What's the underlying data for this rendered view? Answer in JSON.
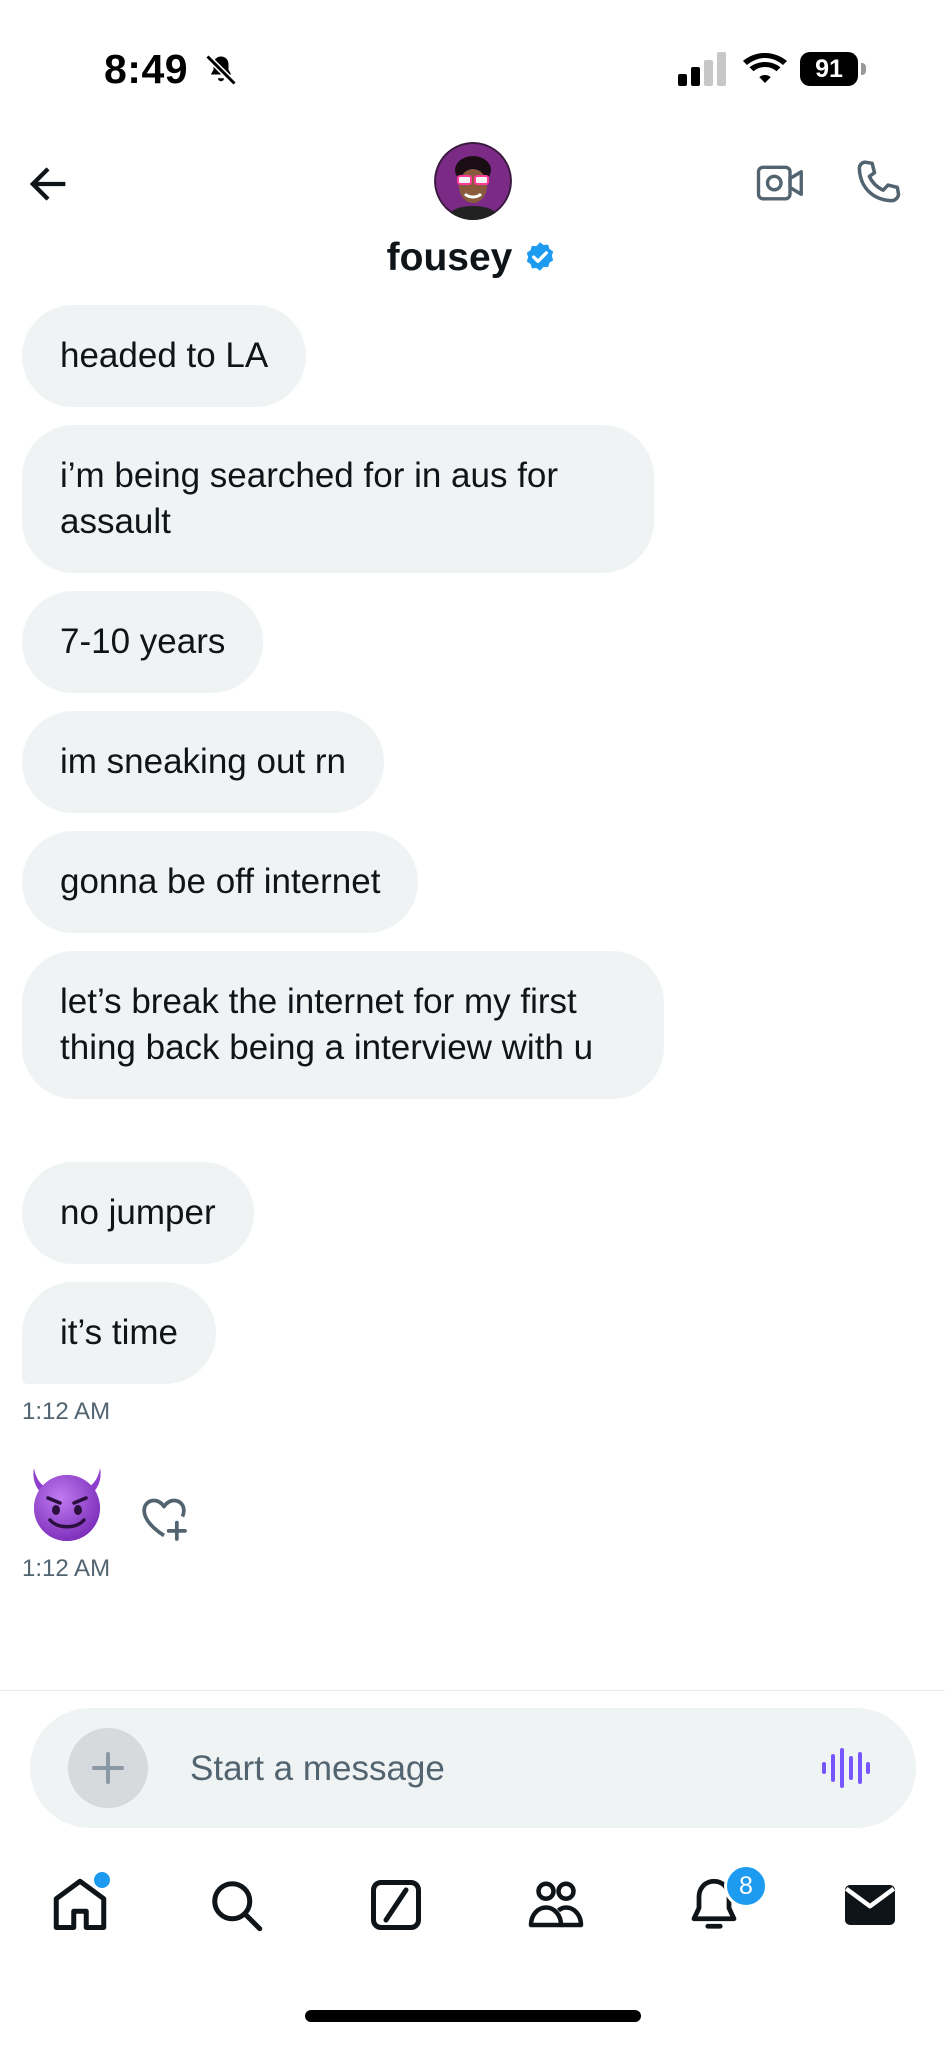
{
  "status_bar": {
    "time": "8:49",
    "battery": "91",
    "icons": [
      "bell-slash-icon",
      "cellular-signal-icon",
      "wifi-icon",
      "battery-icon"
    ]
  },
  "header": {
    "contact_name": "fousey",
    "verified": true,
    "icons": [
      "back-arrow-icon",
      "avatar",
      "verified-badge-icon",
      "video-camera-icon",
      "phone-icon"
    ]
  },
  "messages": [
    {
      "text": "headed to LA"
    },
    {
      "text": "i’m being searched for in aus for assault"
    },
    {
      "text": "7-10 years"
    },
    {
      "text": "im sneaking out rn"
    },
    {
      "text": "gonna be off internet"
    },
    {
      "text": "let’s break the internet for my first thing back being a interview with u"
    },
    {
      "text": "no jumper"
    },
    {
      "text": "it’s time"
    }
  ],
  "timestamps": {
    "group": "1:12 AM",
    "emoji": "1:12 AM"
  },
  "emoji_message": {
    "glyph": "😈",
    "name": "smiling-face-with-horns"
  },
  "composer": {
    "placeholder": "Start a message",
    "icons": [
      "plus-icon",
      "voice-waveform-icon"
    ]
  },
  "tab_bar": {
    "items": [
      "home-icon",
      "search-icon",
      "compose-post-icon",
      "communities-icon",
      "notifications-bell-icon",
      "messages-envelope-icon"
    ],
    "notifications_badge": "8",
    "home_has_dot": true
  },
  "colors": {
    "accent": "#1d9bf0",
    "bubble": "#eff3f4",
    "text": "#0f1419",
    "secondary": "#536471",
    "voice": "#7856ff"
  }
}
